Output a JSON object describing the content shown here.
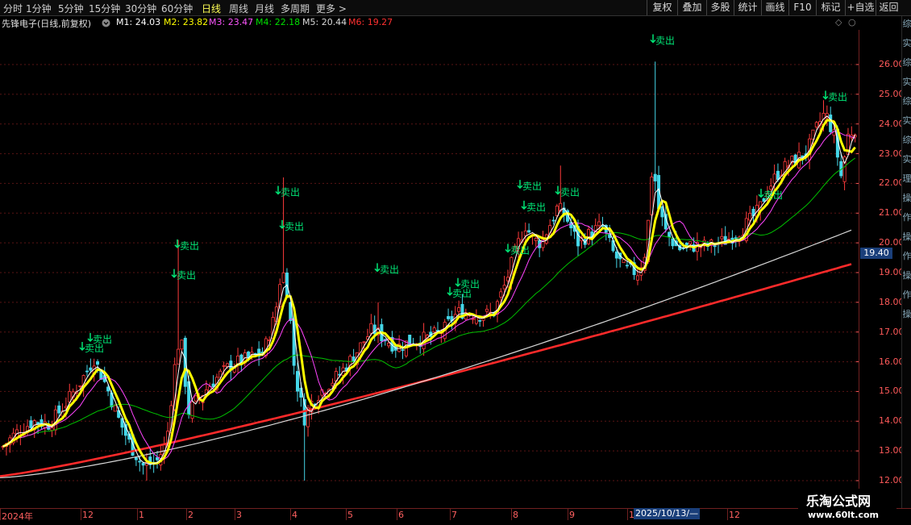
{
  "toolbar": {
    "periods": [
      "分时",
      "1分钟",
      "5分钟",
      "15分钟",
      "30分钟",
      "60分钟",
      "日线",
      "周线",
      "月线",
      "多周期",
      "更多 >"
    ],
    "active_period": "日线",
    "right_buttons": [
      "复权",
      "叠加",
      "多股",
      "统计",
      "画线",
      "F10",
      "标记",
      "+自选",
      "返回"
    ]
  },
  "stock": {
    "title": "先锋电子(日线,前复权)",
    "settings_icon": "gear-icon"
  },
  "ma_legend": [
    {
      "label": "M1: 24.03",
      "color": "#ffffff"
    },
    {
      "label": "M2: 23.82",
      "color": "#ffff00"
    },
    {
      "label": "M3: 23.47",
      "color": "#ff55ff"
    },
    {
      "label": "M4: 22.18",
      "color": "#00e000"
    },
    {
      "label": "M5: 20.44",
      "color": "#d8d8d8"
    },
    {
      "label": "M6: 19.27",
      "color": "#ff3030"
    }
  ],
  "price_axis": [
    "26.00",
    "25.00",
    "24.00",
    "23.00",
    "22.00",
    "21.00",
    "20.00",
    "19.00",
    "18.00",
    "17.00",
    "16.00",
    "15.00",
    "14.00",
    "13.00",
    "12.00"
  ],
  "current_price": "19.40",
  "date_axis": [
    "2024年",
    "12",
    "1",
    "2",
    "3",
    "4",
    "5",
    "6",
    "7",
    "8",
    "9",
    "10",
    "12"
  ],
  "cursor_date": "2025/10/13/—",
  "signal_label": "卖出",
  "watermark": {
    "line1": "乐淘公式网",
    "line2": "www.60lt.com"
  },
  "side_panel_text": "综实综实综实综实理操作操作操作操",
  "colors": {
    "up": "#ff3b3b",
    "down": "#45d6e8",
    "axis": "#ff5a5a",
    "grid": "#5a1414"
  }
}
